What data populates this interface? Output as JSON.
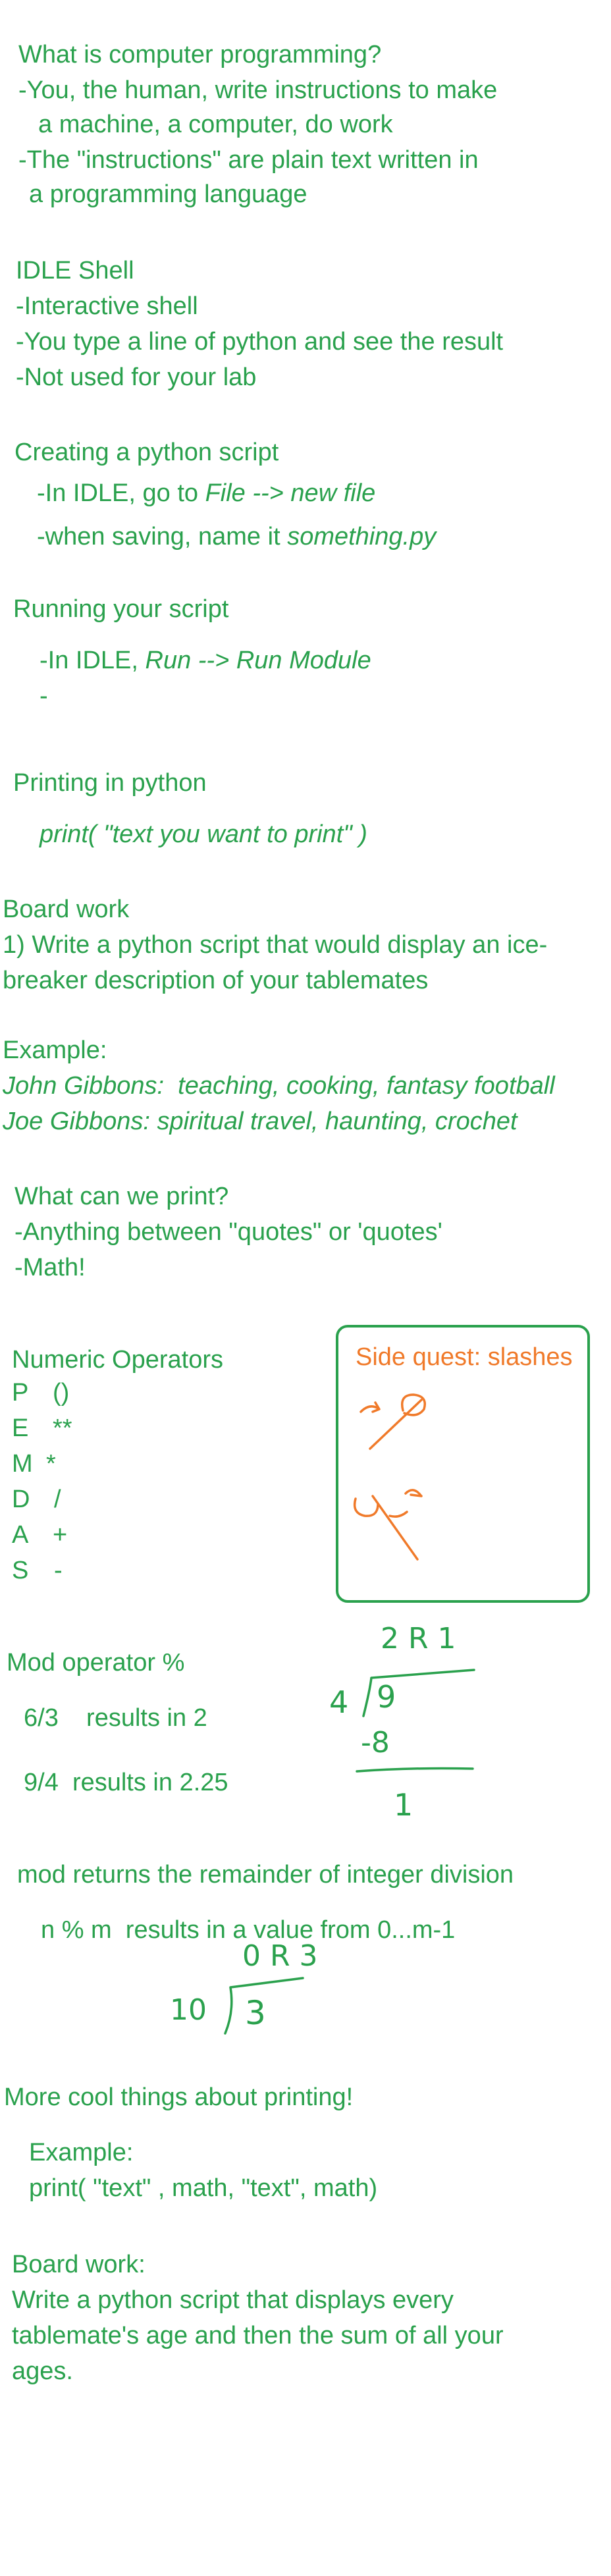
{
  "intro": {
    "heading": "What is computer programming?",
    "line1a": "-You, the human, write instructions to make",
    "line1b": "a machine, a computer, do work",
    "line2a": "-The \"instructions\" are plain text written in",
    "line2b": "a programming language"
  },
  "idle_shell": {
    "heading": "IDLE Shell",
    "items": [
      "-Interactive shell",
      "-You type a line of python and see the result",
      "-Not used for your lab"
    ]
  },
  "creating": {
    "heading": "Creating a python script",
    "line1_prefix": "-In IDLE, go to ",
    "line1_italic": "File --> new file",
    "line2_prefix": "-when saving, name it ",
    "line2_italic": "something.py"
  },
  "running": {
    "heading": "Running your script",
    "line1_prefix": "-In IDLE, ",
    "line1_italic": "Run --> Run Module",
    "line2": "-"
  },
  "printing": {
    "heading": "Printing in python",
    "code": "print( \"text you want to print\" )"
  },
  "board_work_1": {
    "heading": "Board work",
    "line1": "1) Write a python script that would display an ice-",
    "line2": "breaker description of your tablemates"
  },
  "example": {
    "heading": "Example:",
    "line1": "John Gibbons:  teaching, cooking, fantasy football",
    "line2": "Joe Gibbons: spiritual travel, haunting, crochet"
  },
  "what_print": {
    "heading": "What can we print?",
    "line1": "-Anything between \"quotes\" or 'quotes'",
    "line2": "-Math!"
  },
  "numeric": {
    "heading": "Numeric Operators",
    "rows": [
      {
        "letter": "P",
        "op": "()"
      },
      {
        "letter": "E",
        "op": "**"
      },
      {
        "letter": "M",
        "op": "*"
      },
      {
        "letter": "D",
        "op": "/"
      },
      {
        "letter": "A",
        "op": "+"
      },
      {
        "letter": "S",
        "op": "-"
      }
    ]
  },
  "side_quest": {
    "title": "Side quest: slashes"
  },
  "mod": {
    "heading": "Mod operator %",
    "ex1": "6/3    results in 2",
    "ex2": "9/4  results in 2.25",
    "remainder": "mod returns the remainder of integer division",
    "range": "n % m  results in a value from 0...m-1"
  },
  "handwritten": {
    "div1_quotient": "2 R 1",
    "div1_divisor": "4",
    "div1_dividend": "9",
    "div1_subtract": "-8",
    "div1_result": "1",
    "div2_quotient": "0 R 3",
    "div2_divisor": "10",
    "div2_dividend": "3"
  },
  "more_printing": {
    "heading": "More cool things about printing!",
    "example_label": "Example:",
    "code": "print( \"text\" , math, \"text\", math)"
  },
  "board_work_2": {
    "heading": "Board work:",
    "line1": "Write a python script that displays every",
    "line2": "tablemate's age and then the sum of all your",
    "line3": "ages."
  },
  "colors": {
    "text": "#2aa14d",
    "accent": "#f07a2a",
    "background": "#ffffff"
  }
}
